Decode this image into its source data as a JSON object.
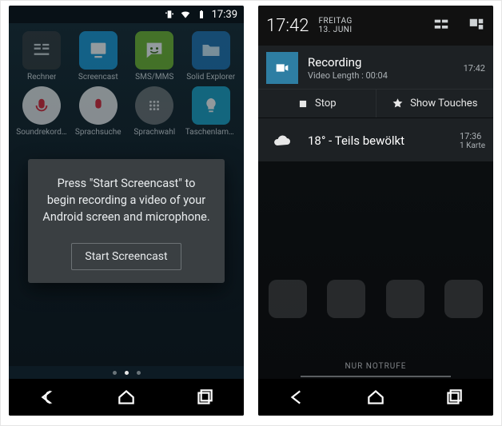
{
  "left": {
    "status": {
      "time": "17:39"
    },
    "apps": [
      {
        "label": "Rechner"
      },
      {
        "label": "Screencast"
      },
      {
        "label": "SMS/MMS"
      },
      {
        "label": "Solid Explorer"
      },
      {
        "label": "Soundrekorder"
      },
      {
        "label": "Sprachsuche"
      },
      {
        "label": "Sprachwahl"
      },
      {
        "label": "Taschenlampe"
      }
    ],
    "dialog": {
      "message": "Press \"Start Screencast\" to begin recording a video of your Android screen and microphone.",
      "button": "Start Screencast"
    }
  },
  "right": {
    "header": {
      "clock": "17:42",
      "weekday": "FREITAG",
      "date": "13. JUNI"
    },
    "recording": {
      "title": "Recording",
      "sub": "Video Length : 00:04",
      "time": "17:42",
      "action_stop": "Stop",
      "action_touches": "Show Touches"
    },
    "weather": {
      "title": "18° - Teils bewölkt",
      "time": "17:36",
      "count": "1 Karte"
    },
    "footer": "NUR NOTRUFE"
  }
}
